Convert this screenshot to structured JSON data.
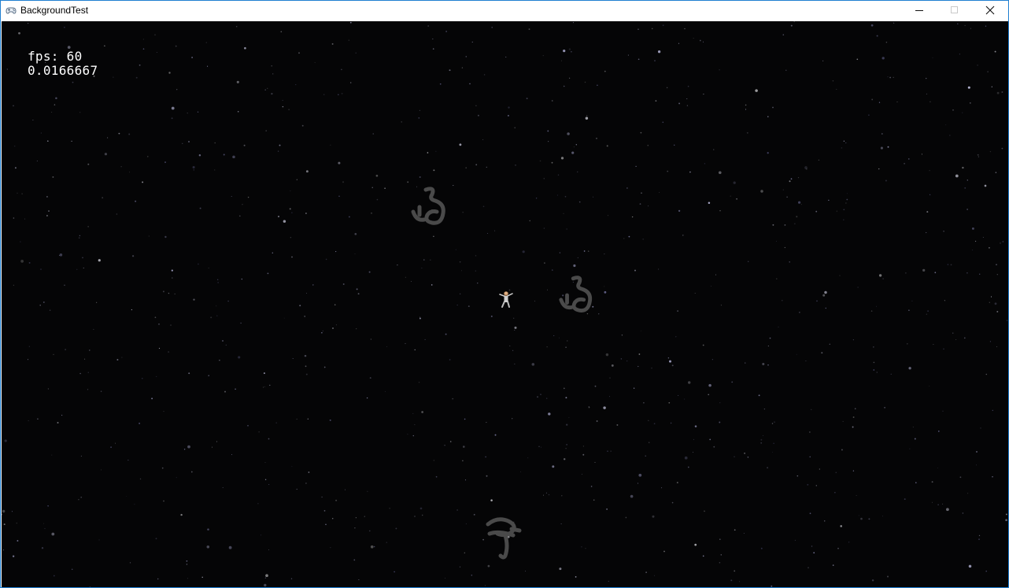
{
  "window": {
    "title": "BackgroundTest",
    "controls": {
      "minimize_icon": "minimize-icon",
      "maximize_icon": "maximize-icon",
      "close_icon": "close-icon"
    }
  },
  "hud": {
    "fps_label": "fps: 60",
    "frame_time": "0.0166667"
  },
  "scene": {
    "background_color": "#050506",
    "player_icon": "astronaut-icon",
    "entity_icons": [
      "scribble-glyph-icon",
      "scribble-glyph-icon",
      "scribble-glyph-icon"
    ]
  }
}
